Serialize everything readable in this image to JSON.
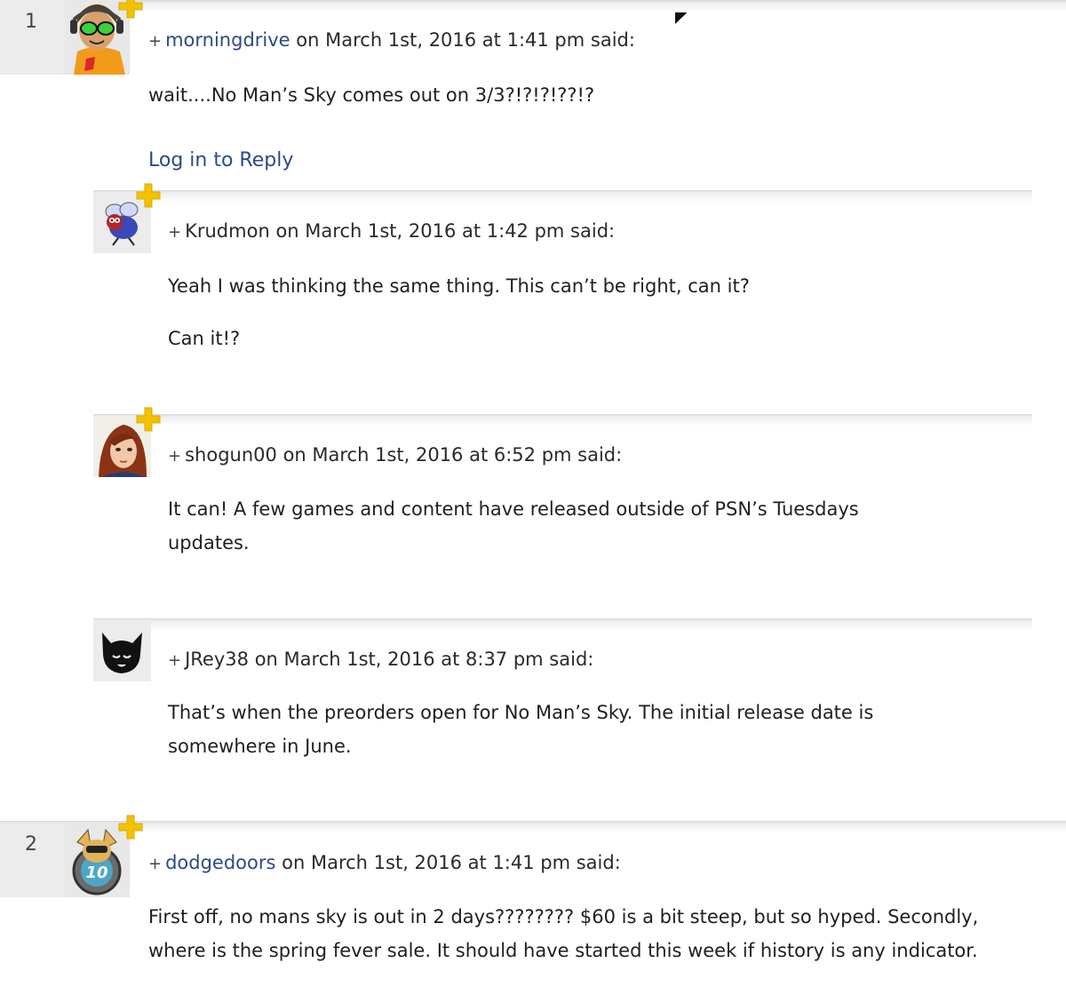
{
  "comments": [
    {
      "number": "1",
      "author": "morningdrive",
      "date": "on March 1st, 2016 at 1:41 pm said:",
      "avatar_icon": "jet-set-radio-character-avatar",
      "body": [
        "wait....No Man’s Sky comes out on 3/3?!?!?!??!?"
      ],
      "reply_label": "Log in to Reply",
      "replies": [
        {
          "author": "Krudmon",
          "date": "on March 1st, 2016 at 1:42 pm said:",
          "avatar_icon": "fly-character-avatar",
          "body": [
            "Yeah I was thinking the same thing. This can’t be right, can it?",
            "Can it!?"
          ]
        },
        {
          "author": "shogun00",
          "date": "on March 1st, 2016 at 6:52 pm said:",
          "avatar_icon": "red-hair-character-avatar",
          "body": [
            "It can! A few games and content have released outside of PSN’s Tuesdays updates."
          ]
        },
        {
          "author": "JRey38",
          "date": "on March 1st, 2016 at 8:37 pm said:",
          "avatar_icon": "black-cat-avatar",
          "body": [
            "That’s when the preorders open for No Man’s Sky. The initial release date is somewhere in June."
          ]
        }
      ]
    },
    {
      "number": "2",
      "author": "dodgedoors",
      "date": "on March 1st, 2016 at 1:41 pm said:",
      "avatar_icon": "ratchet-10-avatar",
      "body": [
        "First off, no mans sky is out in 2 days???????? $60 is a bit steep, but so hyped. Secondly, where is the spring fever sale. It should have started this week if history is any indicator."
      ]
    }
  ],
  "plus_prefix": "+",
  "colors": {
    "link": "#2c4a87",
    "plus_badge": "#f2c200",
    "number_box": "#ececec"
  }
}
